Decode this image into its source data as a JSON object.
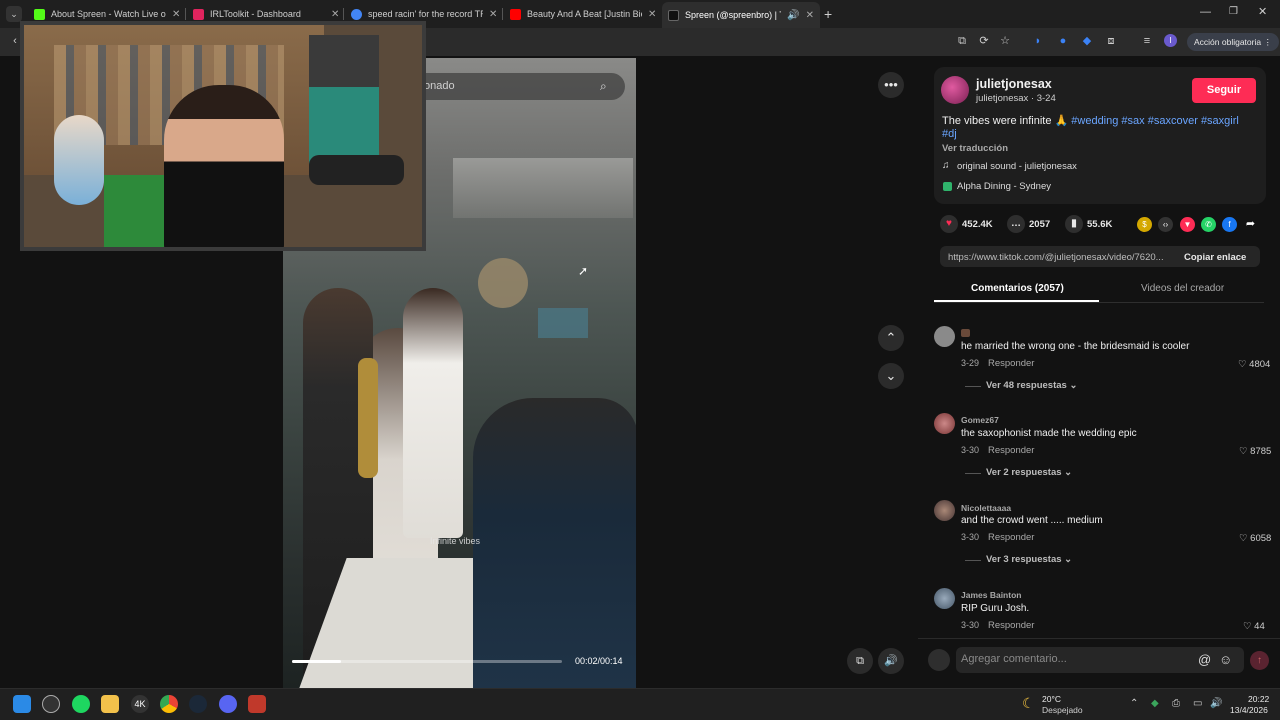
{
  "browser": {
    "tabs": [
      {
        "title": "About Spreen - Watch Live on K",
        "icon": "kick-icon",
        "color": "#53fc18"
      },
      {
        "title": "IRLToolkit - Dashboard",
        "icon": "irltoolkit-icon",
        "color": "#e0245e"
      },
      {
        "title": "speed racin' for the record TRA",
        "icon": "google-icon",
        "color": "#4285f4"
      },
      {
        "title": "Beauty And A Beat [Justin Bieb",
        "icon": "youtube-icon",
        "color": "#ff0000"
      },
      {
        "title": "Spreen (@spreenbro) | TikTo",
        "icon": "tiktok-icon",
        "color": "#111111"
      }
    ],
    "new_tab": "+",
    "action_button": "Acción obligatoria"
  },
  "video": {
    "search_placeholder": "onado",
    "overlay_caption": "Infinite vibes",
    "time": "00:02/00:14",
    "progress_fraction": 0.18
  },
  "post": {
    "username": "julietjonesax",
    "subline": "julietjonesax · 3-24",
    "follow": "Seguir",
    "description": "The vibes were infinite 🙏",
    "hashtags": [
      "#wedding",
      "#sax",
      "#saxcover",
      "#saxgirl",
      "#dj"
    ],
    "translate": "Ver traducción",
    "sound": "original sound - julietjonesax",
    "place": "Alpha Dining - Sydney",
    "likes": "452.4K",
    "comments": "2057",
    "saves": "55.6K",
    "link": "https://www.tiktok.com/@julietjonesax/video/7620...",
    "copy": "Copiar enlace",
    "tab_comments": "Comentarios (2057)",
    "tab_creator": "Videos del creador",
    "comment_placeholder": "Agregar comentario..."
  },
  "comments": [
    {
      "user": "",
      "text": "he married the wrong one - the bridesmaid is cooler",
      "date": "3-29",
      "reply": "Responder",
      "likes": "4804",
      "more": "Ver 48 respuestas"
    },
    {
      "user": "Gomez67",
      "text": "the saxophonist made the wedding epic",
      "date": "3-30",
      "reply": "Responder",
      "likes": "8785",
      "more": "Ver 2 respuestas"
    },
    {
      "user": "Nicolettaaaa",
      "text": "and the crowd went ..... medium",
      "date": "3-30",
      "reply": "Responder",
      "likes": "6058",
      "more": "Ver 3 respuestas"
    },
    {
      "user": "James Bainton",
      "text": "RIP Guru Josh.",
      "date": "3-30",
      "reply": "Responder",
      "likes": "44",
      "more": ""
    }
  ],
  "taskbar": {
    "weather_temp": "20°C",
    "weather_desc": "Despejado",
    "time": "20:22",
    "date": "13/4/2026"
  }
}
